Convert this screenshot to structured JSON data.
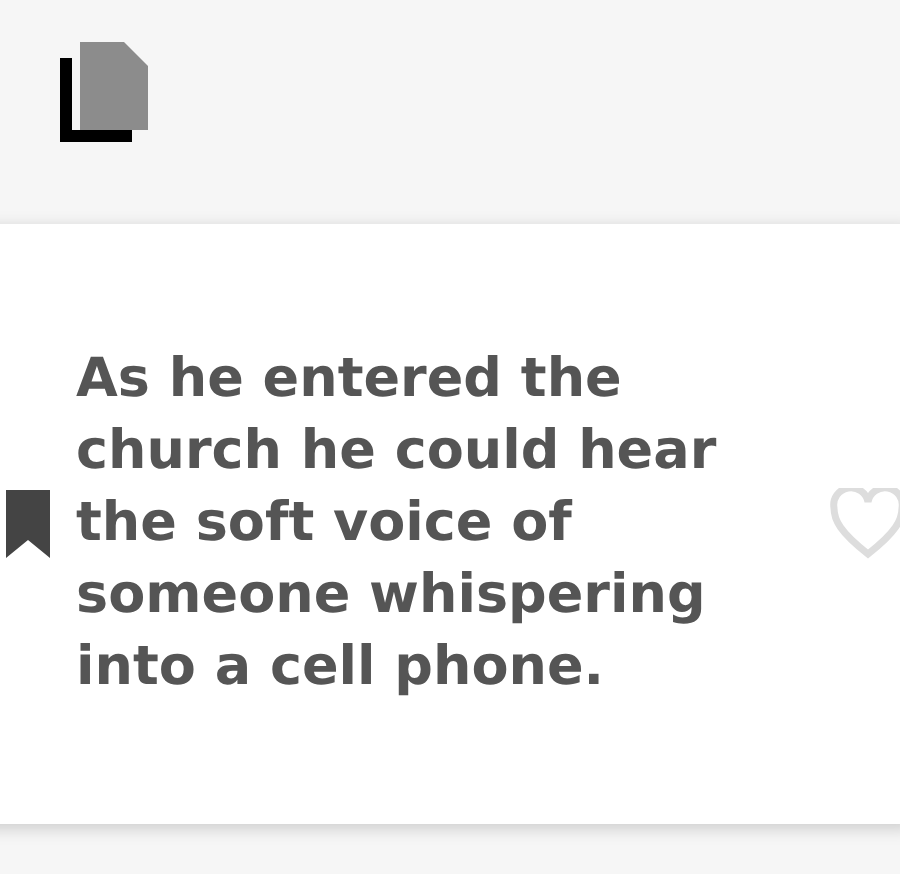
{
  "quote": {
    "text": "As he entered the church he could hear the soft voice of someone whispering into a cell phone.",
    "bookmarked": true,
    "liked": false
  }
}
